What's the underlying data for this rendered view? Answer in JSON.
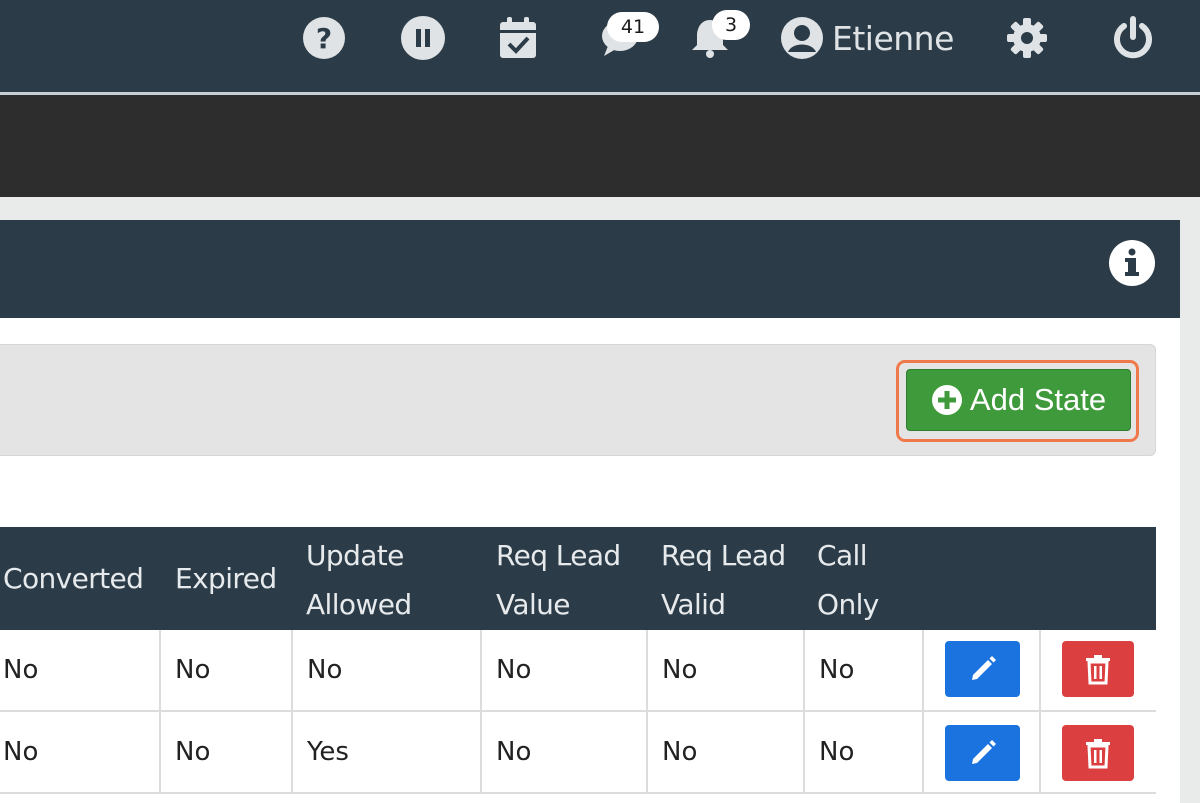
{
  "navbar": {
    "help_icon": "question-circle",
    "pause_icon": "pause-circle",
    "calendar_icon": "calendar-check",
    "messages": {
      "icon": "comment",
      "count": "41"
    },
    "notifications": {
      "icon": "bell",
      "count": "3"
    },
    "user": {
      "icon": "user-circle",
      "name": "Etienne"
    },
    "settings_icon": "gear",
    "power_icon": "power"
  },
  "panel": {
    "info_icon": "info-circle",
    "add_button_label": "Add State",
    "add_button_icon": "plus-circle"
  },
  "table": {
    "headers": [
      {
        "line1": "Converted",
        "line2": ""
      },
      {
        "line1": "Expired",
        "line2": ""
      },
      {
        "line1": "Update",
        "line2": "Allowed"
      },
      {
        "line1": "Req Lead",
        "line2": "Value"
      },
      {
        "line1": "Req Lead",
        "line2": "Valid"
      },
      {
        "line1": "Call",
        "line2": "Only"
      }
    ],
    "rows": [
      [
        "No",
        "No",
        "No",
        "No",
        "No",
        "No"
      ],
      [
        "No",
        "No",
        "Yes",
        "No",
        "No",
        "No"
      ]
    ],
    "edit_icon": "pencil",
    "delete_icon": "trash"
  },
  "colors": {
    "navbar_bg": "#2b3c48",
    "accent_green": "#3f9a3c",
    "edit_blue": "#1b73e0",
    "delete_red": "#db3f3f",
    "highlight_orange": "#f0794b"
  }
}
